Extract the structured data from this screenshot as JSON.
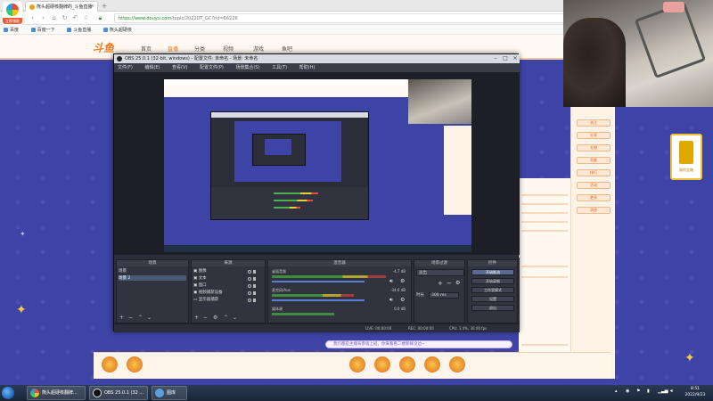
{
  "browser": {
    "logo_label": "立即领取",
    "tab_title": "熊头超硬核翻牌的_斗鱼直播",
    "tab_close": "×",
    "new_tab": "+",
    "url_scheme": "https://",
    "url_host": "www.douyu.com",
    "url_rest": "/topic/2022DT_GC?rid=66226",
    "bookmarks": [
      "百度",
      "百度一下",
      "斗鱼直播",
      "熊头超硬核"
    ]
  },
  "douyu": {
    "logo": "斗鱼",
    "nav": [
      "首页",
      "直播",
      "分类",
      "视频",
      "游戏",
      "鱼吧"
    ],
    "active_nav_index": 1,
    "right_buttons": [
      "关注",
      "分享",
      "礼物",
      "贡献",
      "排行",
      "活动",
      "更多",
      "消息"
    ],
    "gift_card_label": "福利宝箱",
    "notice_text": "我们都是主播背景墙上班，你来看看二楼新鲜没边~"
  },
  "obs": {
    "title": "OBS 25.0.1 (32-bit, windows) - 配置文件: 未命名 - 场景: 未命名",
    "menu": [
      "文件(F)",
      "编辑(E)",
      "查看(V)",
      "配置文件(P)",
      "场景集合(S)",
      "工具(T)",
      "帮助(H)"
    ],
    "docks": {
      "scenes_title": "场景",
      "sources_title": "来源",
      "mixer_title": "混音器",
      "transitions_title": "场景过渡",
      "controls_title": "控件"
    },
    "scenes": [
      "场景",
      "场景 2"
    ],
    "selected_scene_index": 1,
    "sources": [
      "图像",
      "文本",
      "窗口",
      "视频捕获设备",
      "显示器捕获"
    ],
    "mixer": [
      {
        "name": "桌面音频",
        "db": "-4.7 dB"
      },
      {
        "name": "麦克风/Aux",
        "db": "-34.6 dB"
      },
      {
        "name": "媒体源",
        "db": "0.0 dB"
      }
    ],
    "transition": {
      "type": "淡出",
      "duration_label": "时长",
      "duration_value": "300 ms"
    },
    "controls": [
      "开始推流",
      "开始录制",
      "工作室模式",
      "设置",
      "退出"
    ],
    "status": {
      "live": "LIVE: 00:00:00",
      "rec": "REC: 00:00:00",
      "cpu": "CPU: 3.4%, 30.00 fps"
    }
  },
  "taskbar": {
    "tasks": [
      "熊头超硬核翻牌...",
      "OBS 25.0.1 (32 ...",
      "图库"
    ],
    "time": "8:51",
    "date": "2022/9/23"
  },
  "colors": {
    "douyu_orange": "#f47a20",
    "page_purple": "#3e43a6",
    "obs_dark": "#2b2e38"
  }
}
